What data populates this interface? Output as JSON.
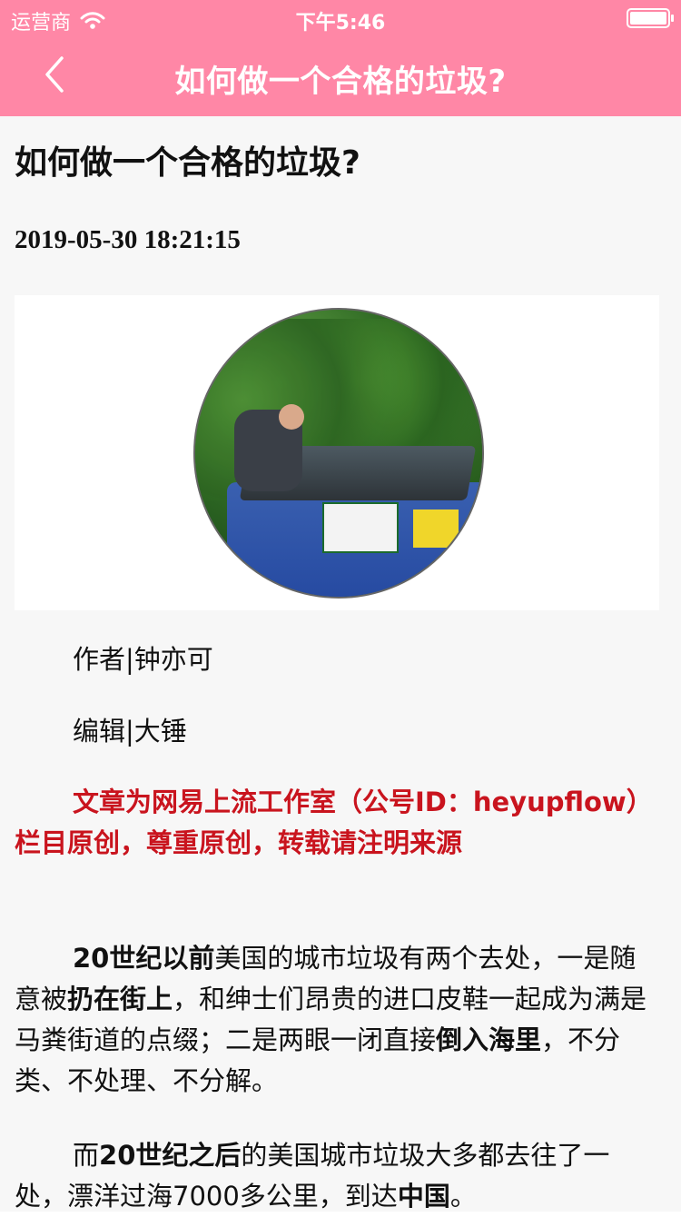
{
  "status_bar": {
    "carrier": "运营商",
    "time": "下午5:46"
  },
  "nav": {
    "title": "如何做一个合格的垃圾?"
  },
  "article": {
    "title": "如何做一个合格的垃圾?",
    "date": "2019-05-30 18:21:15",
    "author": "作者|钟亦可",
    "editor": "编辑|大锤",
    "notice": "文章为网易上流工作室（公号ID：heyupflow）栏目原创，尊重原创，转载请注明来源",
    "paragraphs": [
      {
        "p1_b1": "20世纪以前",
        "p1_t1": "美国的城市垃圾有两个去处，一是随意被",
        "p1_b2": "扔在街上",
        "p1_t2": "，和绅士们昂贵的进口皮鞋一起成为满是马粪街道的点缀；二是两眼一闭直接",
        "p1_b3": "倒入海里",
        "p1_t3": "，不分类、不处理、不分解。"
      },
      {
        "p2_t1": "而",
        "p2_b1": "20世纪之后",
        "p2_t2": "的美国城市垃圾大多都去往了一处，漂洋过海7000多公里，到达",
        "p2_b2": "中国",
        "p2_t3": "。"
      }
    ]
  },
  "icons": {
    "wifi": "wifi-icon",
    "battery": "battery-icon",
    "back": "chevron-left-icon"
  },
  "colors": {
    "brand_pink": "#ff87a6",
    "notice_red": "#c9141e",
    "content_bg": "#f7f7f7"
  }
}
